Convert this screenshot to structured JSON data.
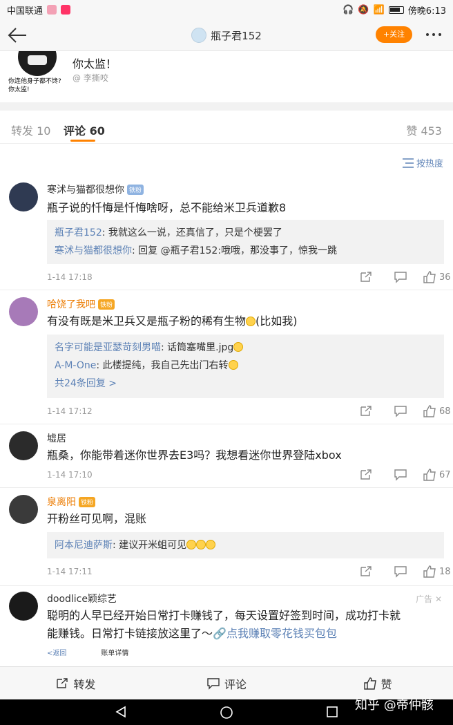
{
  "status_bar": {
    "carrier": "中国联通",
    "time": "傍晚6:13"
  },
  "nav": {
    "title": "瓶子君152",
    "follow_label": "+关注"
  },
  "post": {
    "meme_caption_1": "你连他身子都不馋?",
    "meme_caption_2": "你太监!",
    "text": "你太监！",
    "author": "@ 李撕咬"
  },
  "tabs": [
    {
      "label": "转发 10"
    },
    {
      "label": "评论 60"
    },
    {
      "label": "赞 453"
    }
  ],
  "sort_label": "按热度",
  "comments": [
    {
      "name": "寒沭与猫都很想你",
      "badge": "铁粉",
      "text": "瓶子说的忏悔是忏悔啥呀，总不能给米卫兵道歉8",
      "replies": [
        {
          "name": "瓶子君152",
          "text": ": 我就这么一说，还真信了，只是个梗罢了"
        },
        {
          "name": "寒沭与猫都很想你",
          "text": ": 回复 @瓶子君152:哦哦，那没事了，惊我一跳"
        }
      ],
      "time": "1-14 17:18",
      "likes": "36"
    },
    {
      "name": "哈饶了我吧",
      "badge": "铁粉",
      "text": "有没有既是米卫兵又是瓶子粉的稀有生物",
      "text_tail": "(比如我)",
      "replies": [
        {
          "name": "名字可能是亚瑟苛刻男喵",
          "text": ": 话筒塞嘴里.jpg"
        },
        {
          "name": "A-M-One",
          "text": ": 此楼提纯，我自己先出门右转"
        }
      ],
      "more": "共24条回复 >",
      "time": "1-14 17:12",
      "likes": "68"
    },
    {
      "name": "墟居",
      "text": "瓶桑，你能带着迷你世界去E3吗？我想看迷你世界登陆xbox",
      "time": "1-14 17:10",
      "likes": "67"
    },
    {
      "name": "泉离阳",
      "badge": "铁粉",
      "text": "开粉丝可见啊，混账",
      "replies": [
        {
          "name": "阿本尼迪萨斯",
          "text": ": 建议开米蛆可见"
        }
      ],
      "time": "1-14 17:11",
      "likes": "18"
    },
    {
      "name": "doodlice颖综艺",
      "ad": "广告",
      "text_1": "聪明的人早已经开始日常打卡赚钱了，每天设置好签到时间，成功打卡就",
      "text_2": "能赚钱。日常打卡链接放这里了～",
      "link": "🔗点我赚取零花钱买包包",
      "strip": [
        "<返回",
        "账单详情"
      ]
    }
  ],
  "bottom_bar": {
    "repost": "转发",
    "comment": "评论",
    "like": "赞"
  },
  "watermark": "知乎 @帝仲骸",
  "colors": {
    "accent": "#ff8200",
    "link": "#5d82b6"
  }
}
